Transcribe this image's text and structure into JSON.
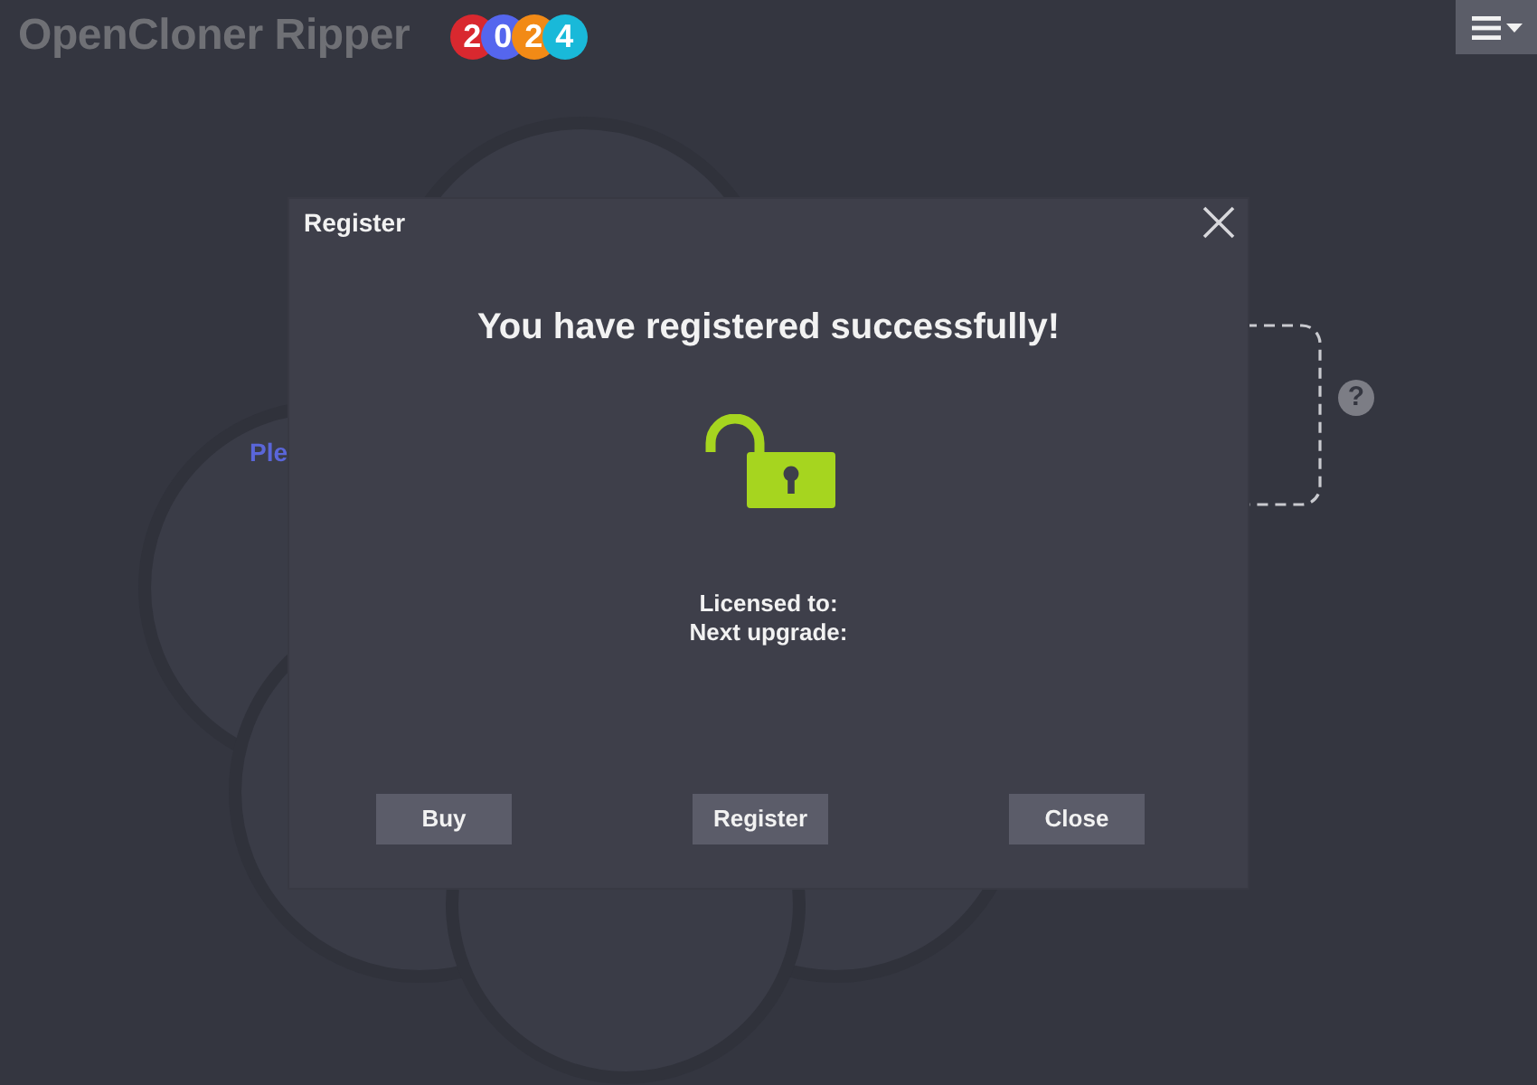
{
  "app": {
    "title": "OpenCloner Ripper",
    "year_badge": [
      {
        "digit": "2",
        "color": "#d9282f"
      },
      {
        "digit": "0",
        "color": "#5566ee"
      },
      {
        "digit": "2",
        "color": "#f28a16"
      },
      {
        "digit": "4",
        "color": "#19b9d9"
      }
    ]
  },
  "background": {
    "prompt_text": "Ple",
    "help_label": "?"
  },
  "dialog": {
    "title": "Register",
    "heading": "You have registered successfully!",
    "license_info": [
      {
        "label": "Licensed to:"
      },
      {
        "label": "Next upgrade:"
      }
    ],
    "buttons": [
      {
        "label": "Buy"
      },
      {
        "label": "Register"
      },
      {
        "label": "Close"
      }
    ]
  }
}
